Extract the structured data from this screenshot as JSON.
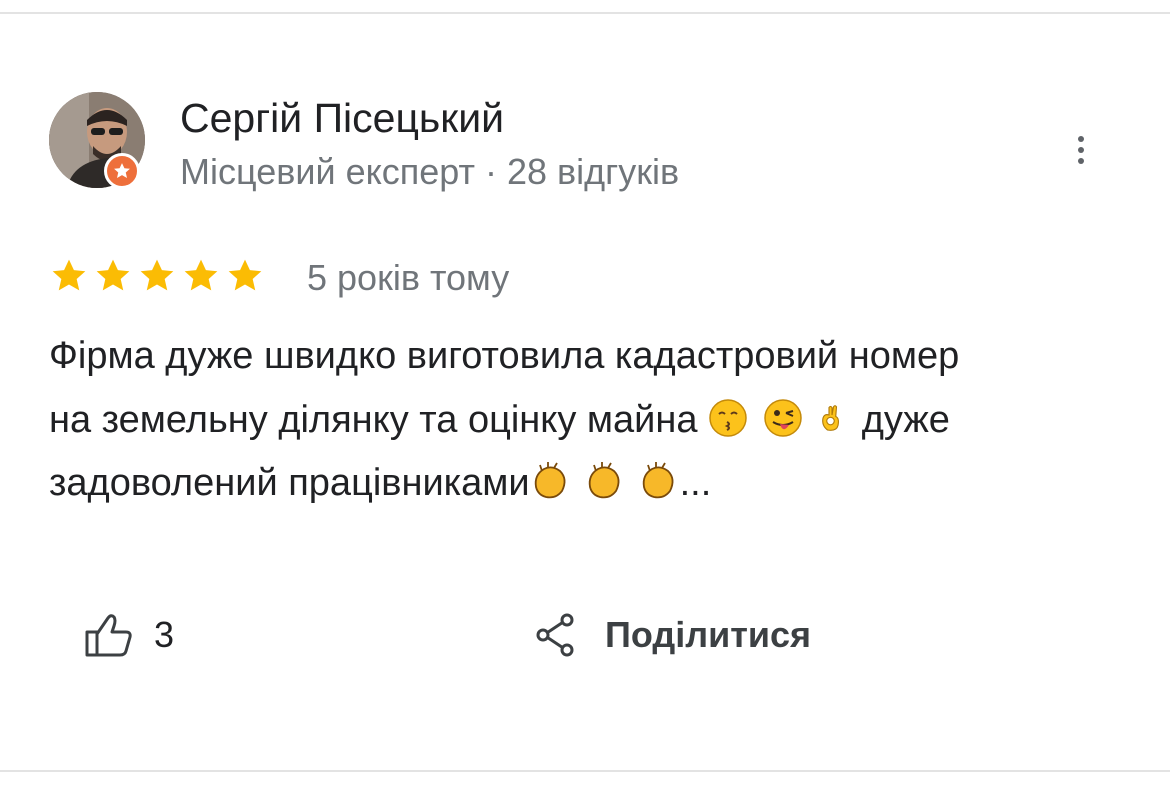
{
  "reviewer": {
    "name": "Сергій Пісецький",
    "meta": "Місцевий експерт · 28 відгуків"
  },
  "rating": {
    "stars": 5,
    "max": 5,
    "color": "#fbbc04",
    "date": "5 років тому"
  },
  "review": {
    "line1": "Фірма дуже швидко виготовила кадастровий номер",
    "line2_start": "на земельну ділянку та оцінку майна",
    "line2_end": "дуже",
    "line3": "задоволений працівниками",
    "ellipsis": "..."
  },
  "actions": {
    "like_count": "3",
    "share_label": "Поділитися"
  },
  "icons": {
    "avatar_badge": "local-guide-star-icon",
    "more": "more-vert-icon",
    "like": "thumb-up-icon",
    "share": "share-icon"
  },
  "colors": {
    "badge": "#ee6f3b",
    "text": "#202124",
    "secondary": "#70757a"
  }
}
